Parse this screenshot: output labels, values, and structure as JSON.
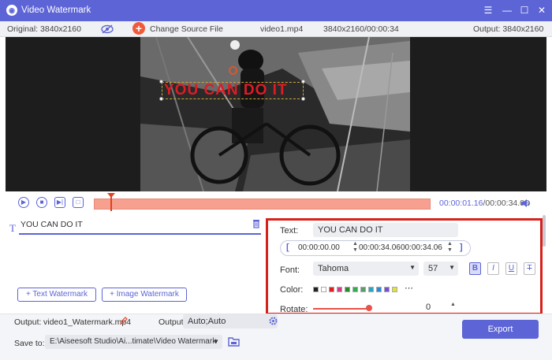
{
  "window": {
    "title": "Video Watermark"
  },
  "info": {
    "original": "Original: 3840x2160",
    "change_source": "Change Source File",
    "filename": "video1.mp4",
    "meta": "3840x2160/00:00:34",
    "output": "Output: 3840x2160"
  },
  "preview": {
    "watermark_text": "YOU CAN DO IT"
  },
  "playback": {
    "current_time": "00:00:01.16",
    "total_time": "/00:00:34.06",
    "progress_fraction": 0.05
  },
  "list": {
    "item_label": "YOU CAN DO IT",
    "text_watermark_btn": "Text Watermark",
    "image_watermark_btn": "Image Watermark"
  },
  "props": {
    "text_label": "Text:",
    "text_value": "YOU CAN DO IT",
    "start_time": "00:00:00.00",
    "end_time": "00:00:34.06",
    "duration": "00:00:34.06",
    "font_label": "Font:",
    "font_value": "Tahoma",
    "size_value": "57",
    "color_label": "Color:",
    "rotate_label": "Rotate:",
    "rotate_value": "0",
    "bold": "B",
    "italic": "I",
    "underline": "U",
    "strike": "T",
    "colors": [
      "#222222",
      "#ffffff",
      "#e21d1d",
      "#d83a8a",
      "#2a8a2a",
      "#2fae4a",
      "#5a9d6a",
      "#26a6c4",
      "#2e8ad8",
      "#7b4fd0",
      "#dfe23a"
    ]
  },
  "footer": {
    "output_label": "Output:",
    "output_file": "video1_Watermark.mp4",
    "output_label2": "Output:",
    "output_setting": "Auto;Auto",
    "save_label": "Save to:",
    "save_path": "E:\\Aiseesoft Studio\\Ai...timate\\Video Watermark",
    "export": "Export"
  }
}
